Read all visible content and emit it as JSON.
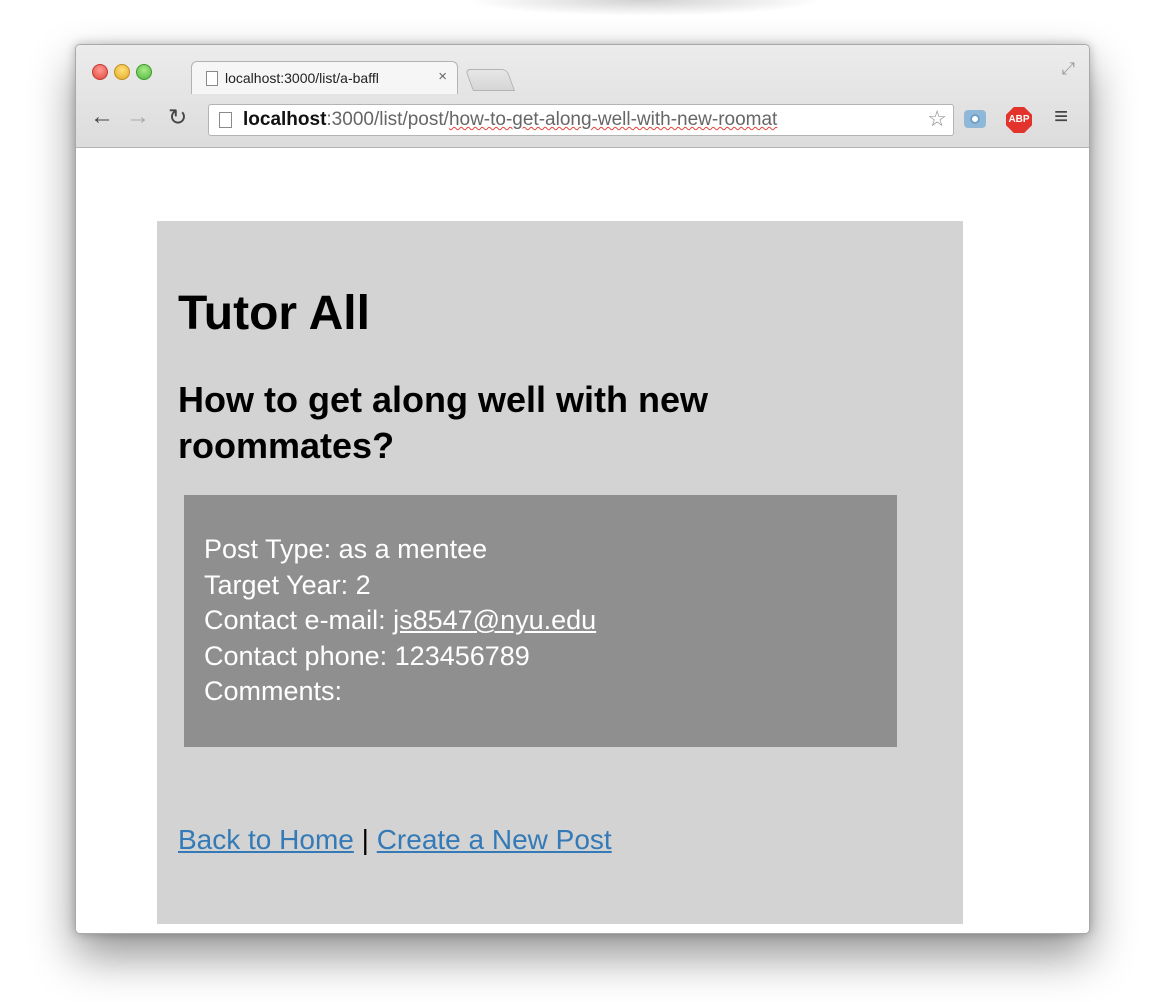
{
  "browser": {
    "tab": {
      "title": "localhost:3000/list/a-baffl",
      "close_glyph": "×"
    },
    "address_bar": {
      "host": "localhost",
      "port_path": ":3000/list/post/",
      "slug": "how-to-get-along-well-with-new-roomat"
    },
    "toolbar_icons": [
      "back-arrow-icon",
      "forward-arrow-icon",
      "reload-icon",
      "page-icon",
      "star-icon",
      "camera-icon",
      "abp-icon",
      "menu-icon"
    ],
    "abp_label": "ABP"
  },
  "page": {
    "site_title": "Tutor All",
    "post_title": "How to get along well with new roommates?",
    "details": {
      "post_type_label": "Post Type:",
      "post_type_value": "as a mentee",
      "target_year_label": "Target Year:",
      "target_year_value": "2",
      "email_label": "Contact e-mail:",
      "email_value": "js8547@nyu.edu",
      "phone_label": "Contact phone:",
      "phone_value": "123456789",
      "comments_label": "Comments:"
    },
    "footer": {
      "home_link": "Back to Home",
      "separator": "|",
      "create_link": "Create a New Post"
    },
    "expand_glyph": "+"
  },
  "colors": {
    "card_background": "#d3d3d3",
    "info_box_background": "#8f8f8f",
    "link": "#337ab7"
  }
}
